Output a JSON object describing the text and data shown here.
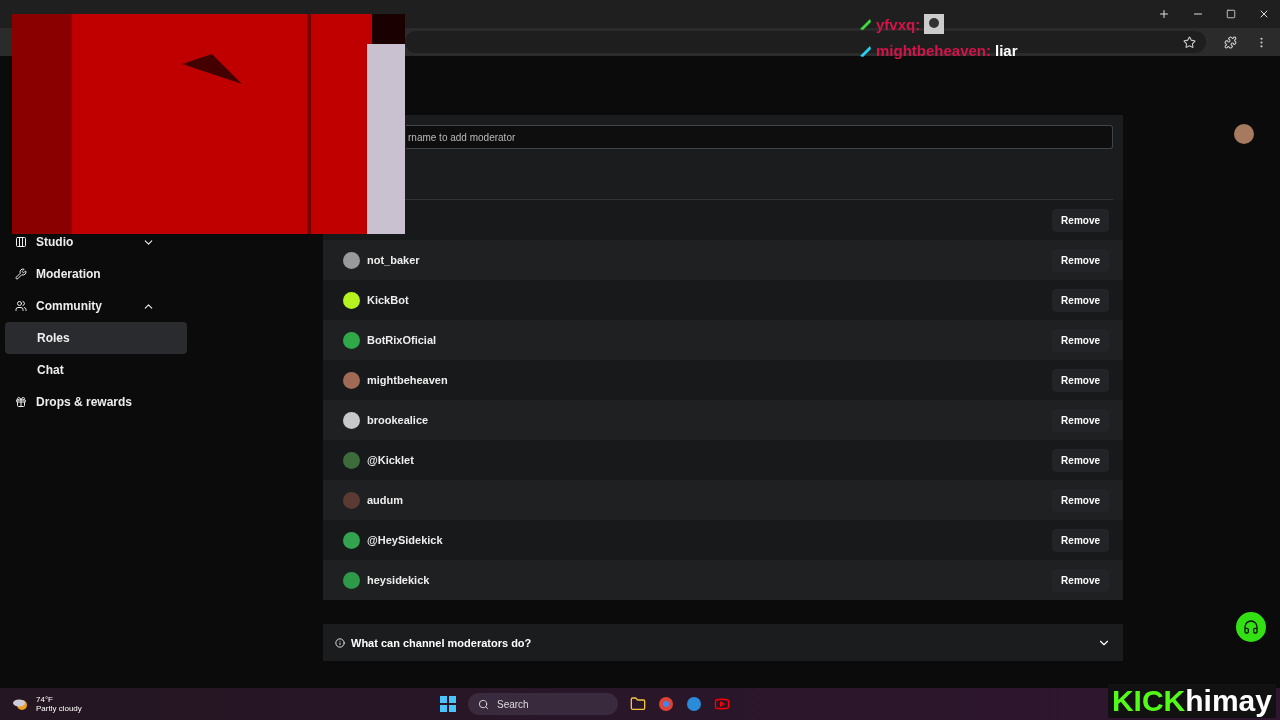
{
  "sidebar": {
    "items": [
      {
        "label": "Studio",
        "expanded": false,
        "selected": false
      },
      {
        "label": "Moderation",
        "selected": false
      },
      {
        "label": "Community",
        "expanded": true,
        "selected": false,
        "children": [
          {
            "label": "Roles",
            "selected": true
          },
          {
            "label": "Chat",
            "selected": false
          }
        ]
      },
      {
        "label": "Drops & rewards",
        "selected": false
      }
    ]
  },
  "add_field": {
    "placeholder": "rname to add moderator"
  },
  "moderators": [
    {
      "button": "Remove"
    },
    {
      "name": "not_baker",
      "color": "#9a9a9a",
      "button": "Remove"
    },
    {
      "name": "KickBot",
      "color": "#b6f21f",
      "button": "Remove"
    },
    {
      "name": "BotRixOficial",
      "color": "#2fa84a",
      "button": "Remove"
    },
    {
      "name": "mightbeheaven",
      "color": "#a06a55",
      "button": "Remove"
    },
    {
      "name": "brookealice",
      "color": "#c8c8c8",
      "button": "Remove"
    },
    {
      "name": "@Kicklet",
      "color": "#3c6b3c",
      "button": "Remove"
    },
    {
      "name": "audum",
      "color": "#5a3b33",
      "button": "Remove"
    },
    {
      "name": "@HeySidekick",
      "color": "#33a34f",
      "button": "Remove"
    },
    {
      "name": "heysidekick",
      "color": "#2e9a49",
      "button": "Remove"
    }
  ],
  "faq": {
    "question": "What can channel moderators do?",
    "expanded": false
  },
  "chat_overlay": [
    {
      "user": "yfvxq:",
      "kind": "emote"
    },
    {
      "user": "mightbeheaven:",
      "kind": "text",
      "message": "liar"
    }
  ],
  "taskbar": {
    "temperature": "74°F",
    "weather": "Partly cloudy",
    "search": "Search"
  },
  "stream_logo": {
    "brand": "KICK",
    "channel": "himay"
  }
}
